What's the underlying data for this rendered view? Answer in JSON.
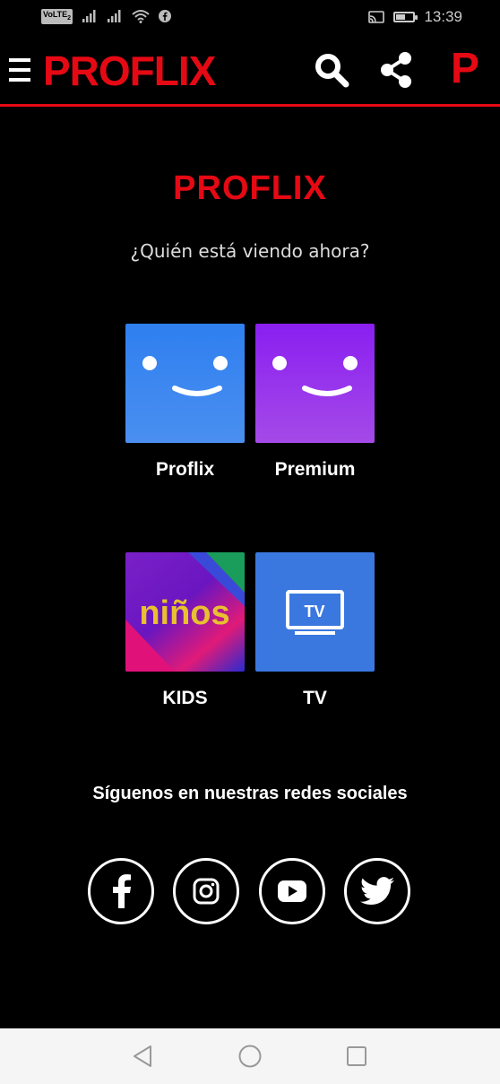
{
  "status_bar": {
    "volte": "VoLTE",
    "volte_sub": "2",
    "time": "13:39",
    "battery_level": 0.55
  },
  "header": {
    "logo": "PROFLIX",
    "profile_initial": "P",
    "accent_color": "#e50914"
  },
  "main": {
    "brand": "PROFLIX",
    "question": "¿Quién está viendo ahora?",
    "profiles": [
      {
        "name": "Proflix",
        "avatar": "smiley-blue"
      },
      {
        "name": "Premium",
        "avatar": "smiley-purple"
      },
      {
        "name": "KIDS",
        "avatar": "ninos",
        "avatar_text": "niños"
      },
      {
        "name": "TV",
        "avatar": "tv",
        "avatar_text": "TV"
      }
    ]
  },
  "social": {
    "title": "Síguenos en nuestras redes sociales",
    "links": [
      "facebook-icon",
      "instagram-icon",
      "youtube-icon",
      "twitter-icon"
    ]
  },
  "navigation_bar": {
    "buttons": [
      "back-icon",
      "home-icon",
      "recents-icon"
    ]
  }
}
